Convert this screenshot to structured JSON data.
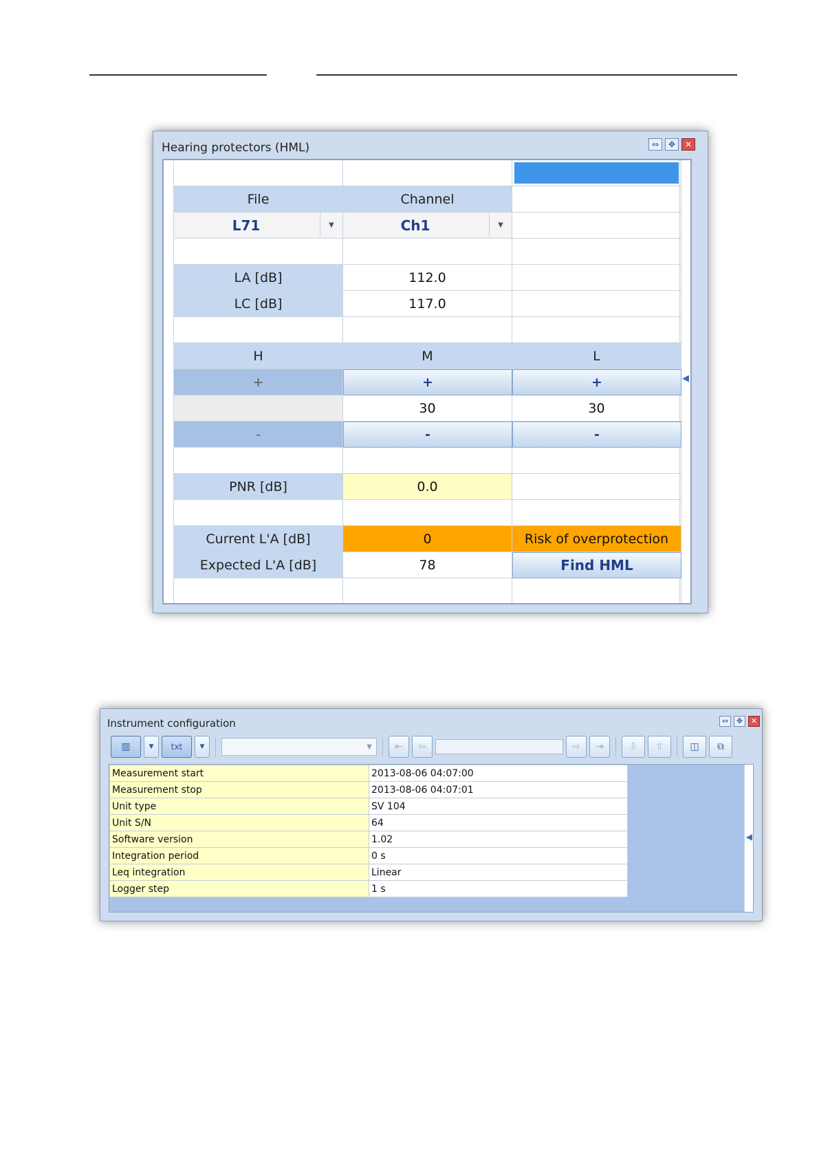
{
  "hml_window": {
    "title": "Hearing protectors (HML)",
    "file_label": "File",
    "channel_label": "Channel",
    "file_value": "L71",
    "channel_value": "Ch1",
    "la_label": "LA [dB]",
    "la_value": "112.0",
    "lc_label": "LC [dB]",
    "lc_value": "117.0",
    "band_headers": [
      "H",
      "M",
      "L"
    ],
    "plus_label": "+",
    "minus_label": "-",
    "band_values": [
      "",
      "30",
      "30"
    ],
    "pnr_label": "PNR [dB]",
    "pnr_value": "0.0",
    "current_label": "Current L'A [dB]",
    "current_value": "0",
    "current_status": "Risk of overprotection",
    "expected_label": "Expected L'A [dB]",
    "expected_value": "78",
    "find_button": "Find HML",
    "colors": {
      "header_bg": "#c5d8ef",
      "selection": "#3f95e8",
      "pnr_bg": "#ffffc4",
      "warning": "#ffa500"
    }
  },
  "config_window": {
    "title": "Instrument configuration",
    "toolbar": {
      "view_icon": "columns-icon",
      "txt_icon": "txt-icon",
      "icons": [
        "first-icon",
        "prev-icon",
        "next-icon",
        "last-icon",
        "down-arrow-icon",
        "up-arrow-icon",
        "tile-icon",
        "copy-icon"
      ]
    },
    "rows": [
      {
        "key": "Measurement start",
        "value": "2013-08-06 04:07:00"
      },
      {
        "key": "Measurement stop",
        "value": "2013-08-06 04:07:01"
      },
      {
        "key": "Unit type",
        "value": "SV 104"
      },
      {
        "key": "Unit S/N",
        "value": "64"
      },
      {
        "key": "Software version",
        "value": "1.02"
      },
      {
        "key": "Integration period",
        "value": "0 s"
      },
      {
        "key": "Leq integration",
        "value": "Linear"
      },
      {
        "key": "Logger step",
        "value": "1 s"
      }
    ]
  }
}
